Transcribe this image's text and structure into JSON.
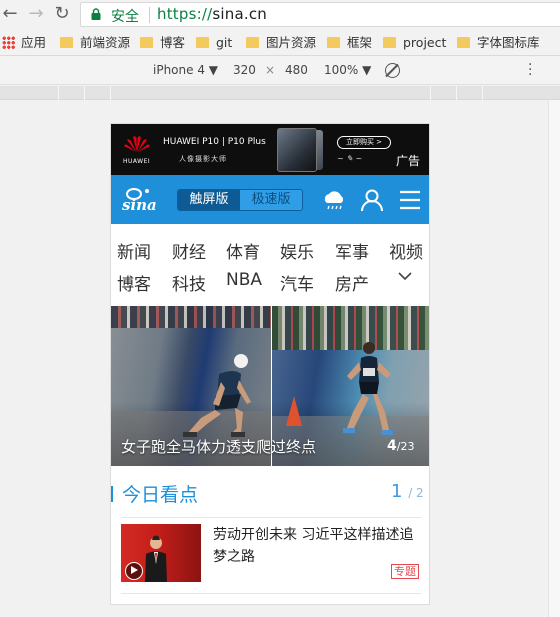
{
  "browser": {
    "security_label": "安全",
    "url_scheme": "https://",
    "url_host": "sina.cn"
  },
  "bookmarks": [
    {
      "label": "应用",
      "type": "apps"
    },
    {
      "label": "前端资源",
      "type": "folder"
    },
    {
      "label": "博客",
      "type": "folder"
    },
    {
      "label": "git",
      "type": "folder"
    },
    {
      "label": "图片资源",
      "type": "folder"
    },
    {
      "label": "框架",
      "type": "folder"
    },
    {
      "label": "project",
      "type": "folder"
    },
    {
      "label": "字体图标库",
      "type": "folder"
    }
  ],
  "devtools": {
    "device": "iPhone 4 ▼",
    "width": "320",
    "times": "×",
    "height": "480",
    "zoom": "100% ▼"
  },
  "ad": {
    "brand": "HUAWEI",
    "title": "HUAWEI P10 | P10 Plus",
    "subtitle": "人像摄影大师",
    "buy_label": "立即购买 >",
    "tag": "广告"
  },
  "header": {
    "logo": "sina",
    "version_touch": "触屏版",
    "version_fast": "极速版"
  },
  "channels": {
    "row1": [
      "新闻",
      "财经",
      "体育",
      "娱乐",
      "军事",
      "视频"
    ],
    "row2": [
      "博客",
      "科技",
      "NBA",
      "汽车",
      "房产"
    ]
  },
  "slideshow": {
    "caption": "女子跑全马体力透支爬过终点",
    "current": "4",
    "total": "/23"
  },
  "today": {
    "title": "今日看点",
    "page": "1",
    "page_total": "/ 2"
  },
  "news": [
    {
      "title": "劳动开创未来 习近平这样描述追梦之路",
      "badge": "专题"
    }
  ],
  "colors": {
    "accent": "#1e8fd8",
    "secure": "#0b8043",
    "badge": "#e5484d"
  }
}
